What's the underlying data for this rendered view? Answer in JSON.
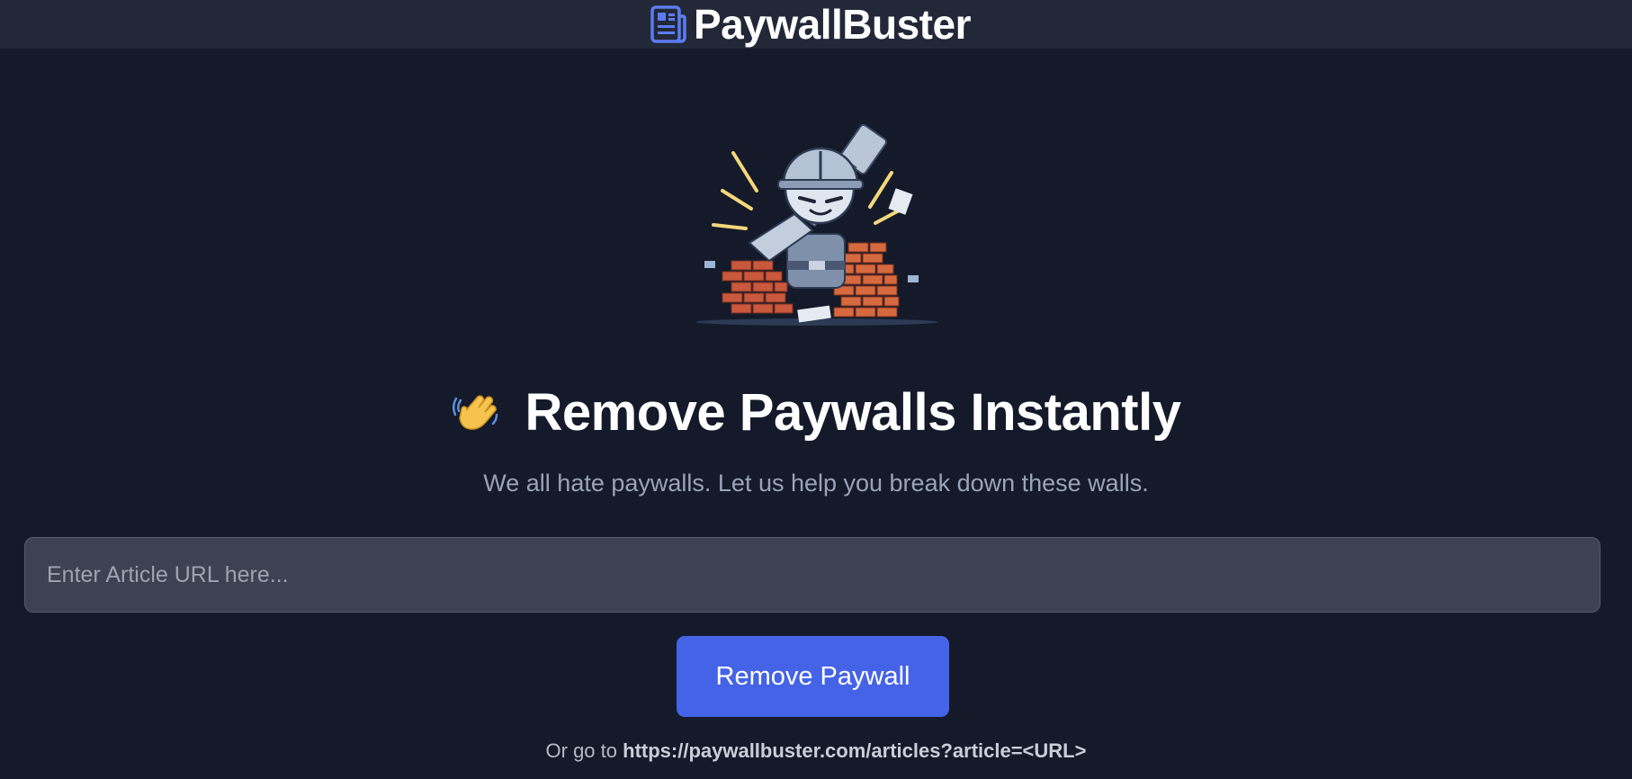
{
  "header": {
    "icon": "newspaper-icon",
    "title": "PaywallBuster",
    "icon_color": "#5b7cf0"
  },
  "hero": {
    "image": "paywall-breaker-mascot-illustration"
  },
  "main": {
    "headline_icon": "waving-hand-icon",
    "headline": "Remove Paywalls Instantly",
    "subtitle": "We all hate paywalls. Let us help you break down these walls.",
    "url_input": {
      "value": "",
      "placeholder": "Enter Article URL here..."
    },
    "submit_label": "Remove Paywall",
    "footnote_prefix": "Or go to",
    "footnote_url": "https://paywallbuster.com/articles?article=<URL>"
  },
  "colors": {
    "background": "#141a29",
    "header_background": "#222838",
    "accent": "#4563e6",
    "input_background": "#3d4252"
  }
}
